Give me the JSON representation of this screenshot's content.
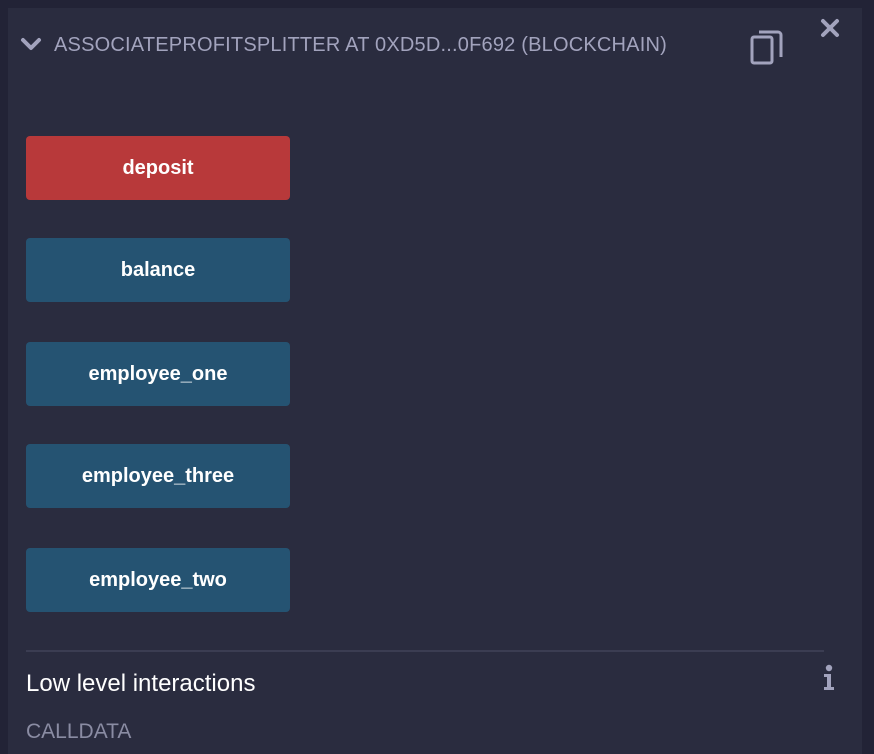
{
  "header": {
    "title": "ASSOCIATEPROFITSPLITTER AT 0XD5D...0F692 (BLOCKCHAIN)",
    "chevron_icon": "chevron-down-icon",
    "copy_icon": "clipboard-copy-icon",
    "close_icon": "close-icon"
  },
  "functions": [
    {
      "label": "deposit",
      "kind": "payable",
      "color": "#b8393a"
    },
    {
      "label": "balance",
      "kind": "view",
      "color": "#255372"
    },
    {
      "label": "employee_one",
      "kind": "view",
      "color": "#255372"
    },
    {
      "label": "employee_three",
      "kind": "view",
      "color": "#255372"
    },
    {
      "label": "employee_two",
      "kind": "view",
      "color": "#255372"
    }
  ],
  "low_level": {
    "title": "Low level interactions",
    "info_icon": "info-icon",
    "calldata_label": "CALLDATA"
  },
  "colors": {
    "background": "#222336",
    "panel": "#2a2c3f",
    "text_muted": "#a2a3bd"
  }
}
